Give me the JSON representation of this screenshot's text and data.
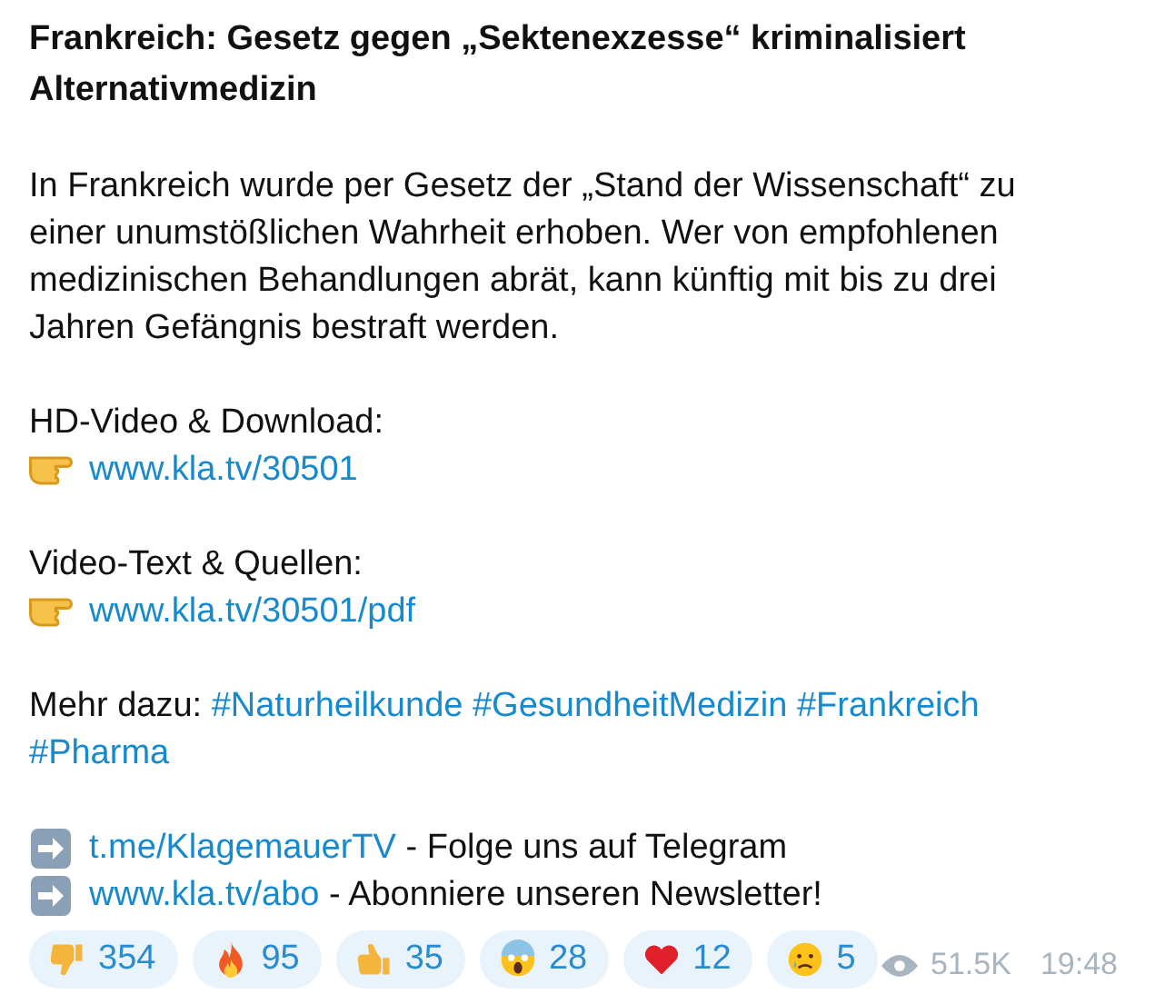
{
  "title": "Frankreich: Gesetz gegen „Sektenexzesse“ kriminalisiert Alternativmedizin",
  "body": "In Frankreich wurde per Gesetz der „Stand der Wissenschaft“ zu einer unumstößlichen Wahrheit erhoben. Wer von empfohlenen medizinischen Behandlungen abrät, kann künftig mit bis zu drei Jahren Gefängnis bestraft werden.",
  "sections": [
    {
      "label": "HD-Video & Download:",
      "link": "www.kla.tv/30501"
    },
    {
      "label": "Video-Text & Quellen:",
      "link": "www.kla.tv/30501/pdf"
    }
  ],
  "more": {
    "label": "Mehr dazu:",
    "tags": [
      "#Naturheilkunde",
      "#GesundheitMedizin",
      "#Frankreich",
      "#Pharma"
    ]
  },
  "links": [
    {
      "link": "t.me/KlagemauerTV",
      "text": "- Folge uns auf Telegram"
    },
    {
      "link": "www.kla.tv/abo",
      "text": "- Abonniere unseren Newsletter!"
    }
  ],
  "reactions": [
    {
      "kind": "thumbs_down",
      "count": "354"
    },
    {
      "kind": "fire",
      "count": "95"
    },
    {
      "kind": "thumbs_up",
      "count": "35"
    },
    {
      "kind": "scream",
      "count": "28"
    },
    {
      "kind": "heart",
      "count": "12"
    },
    {
      "kind": "cry",
      "count": "5"
    }
  ],
  "views": "51.5K",
  "time": "19:48"
}
